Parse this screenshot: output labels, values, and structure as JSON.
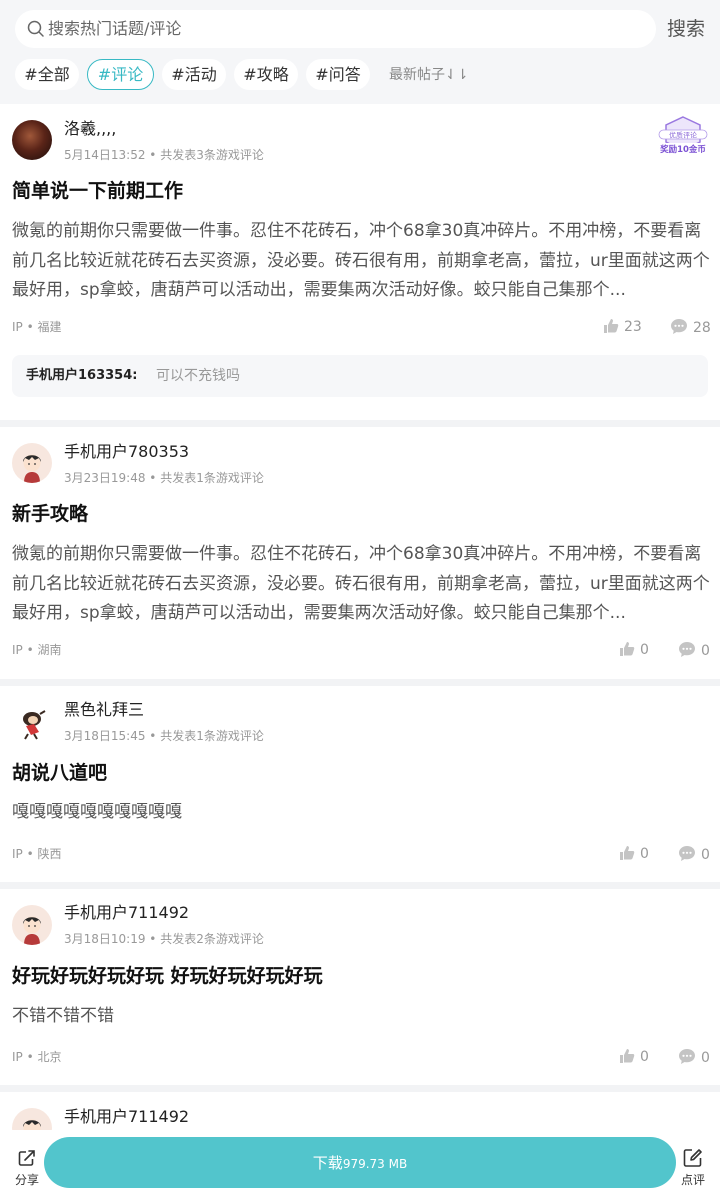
{
  "search": {
    "placeholder": "搜索热门话题/评论",
    "button": "搜索"
  },
  "tags": [
    "#全部",
    "#评论",
    "#活动",
    "#攻略",
    "#问答"
  ],
  "sort_label": "最新帖子⇃⇂",
  "badge": {
    "line1": "优质评论",
    "line2": "奖励10金币"
  },
  "posts": [
    {
      "user": "洛羲,,,,",
      "meta": "5月14日13:52 • 共发表3条游戏评论",
      "title": "简单说一下前期工作",
      "content": "微氪的前期你只需要做一件事。忍住不花砖石，冲个68拿30真冲碎片。不用冲榜，不要看离前几名比较近就花砖石去买资源，没必要。砖石很有用，前期拿老高，蕾拉，ur里面就这两个最好用，sp拿蛟，唐葫芦可以活动出，需要集两次活动好像。蛟只能自己集那个...",
      "location": "IP • 福建",
      "likes": "23",
      "comments": "28",
      "reply_user": "手机用户163354:",
      "reply_text": "可以不充钱吗"
    },
    {
      "user": "手机用户780353",
      "meta": "3月23日19:48 • 共发表1条游戏评论",
      "title": "新手攻略",
      "content": "微氪的前期你只需要做一件事。忍住不花砖石，冲个68拿30真冲碎片。不用冲榜，不要看离前几名比较近就花砖石去买资源，没必要。砖石很有用，前期拿老高，蕾拉，ur里面就这两个最好用，sp拿蛟，唐葫芦可以活动出，需要集两次活动好像。蛟只能自己集那个...",
      "location": "IP • 湖南",
      "likes": "0",
      "comments": "0"
    },
    {
      "user": "黑色礼拜三",
      "meta": "3月18日15:45 • 共发表1条游戏评论",
      "title": "胡说八道吧",
      "content": "嘎嘎嘎嘎嘎嘎嘎嘎嘎嘎",
      "location": "IP • 陕西",
      "likes": "0",
      "comments": "0"
    },
    {
      "user": "手机用户711492",
      "meta": "3月18日10:19 • 共发表2条游戏评论",
      "title": "好玩好玩好玩好玩 好玩好玩好玩好玩",
      "content": "不错不错不错",
      "location": "IP • 北京",
      "likes": "0",
      "comments": "0"
    },
    {
      "user": "手机用户711492"
    }
  ],
  "bottom": {
    "share": "分享",
    "download_main": "下载",
    "download_size": "979.73 MB",
    "review": "点评"
  },
  "colors": {
    "accent": "#38b9c4",
    "download": "#52c5cc"
  }
}
